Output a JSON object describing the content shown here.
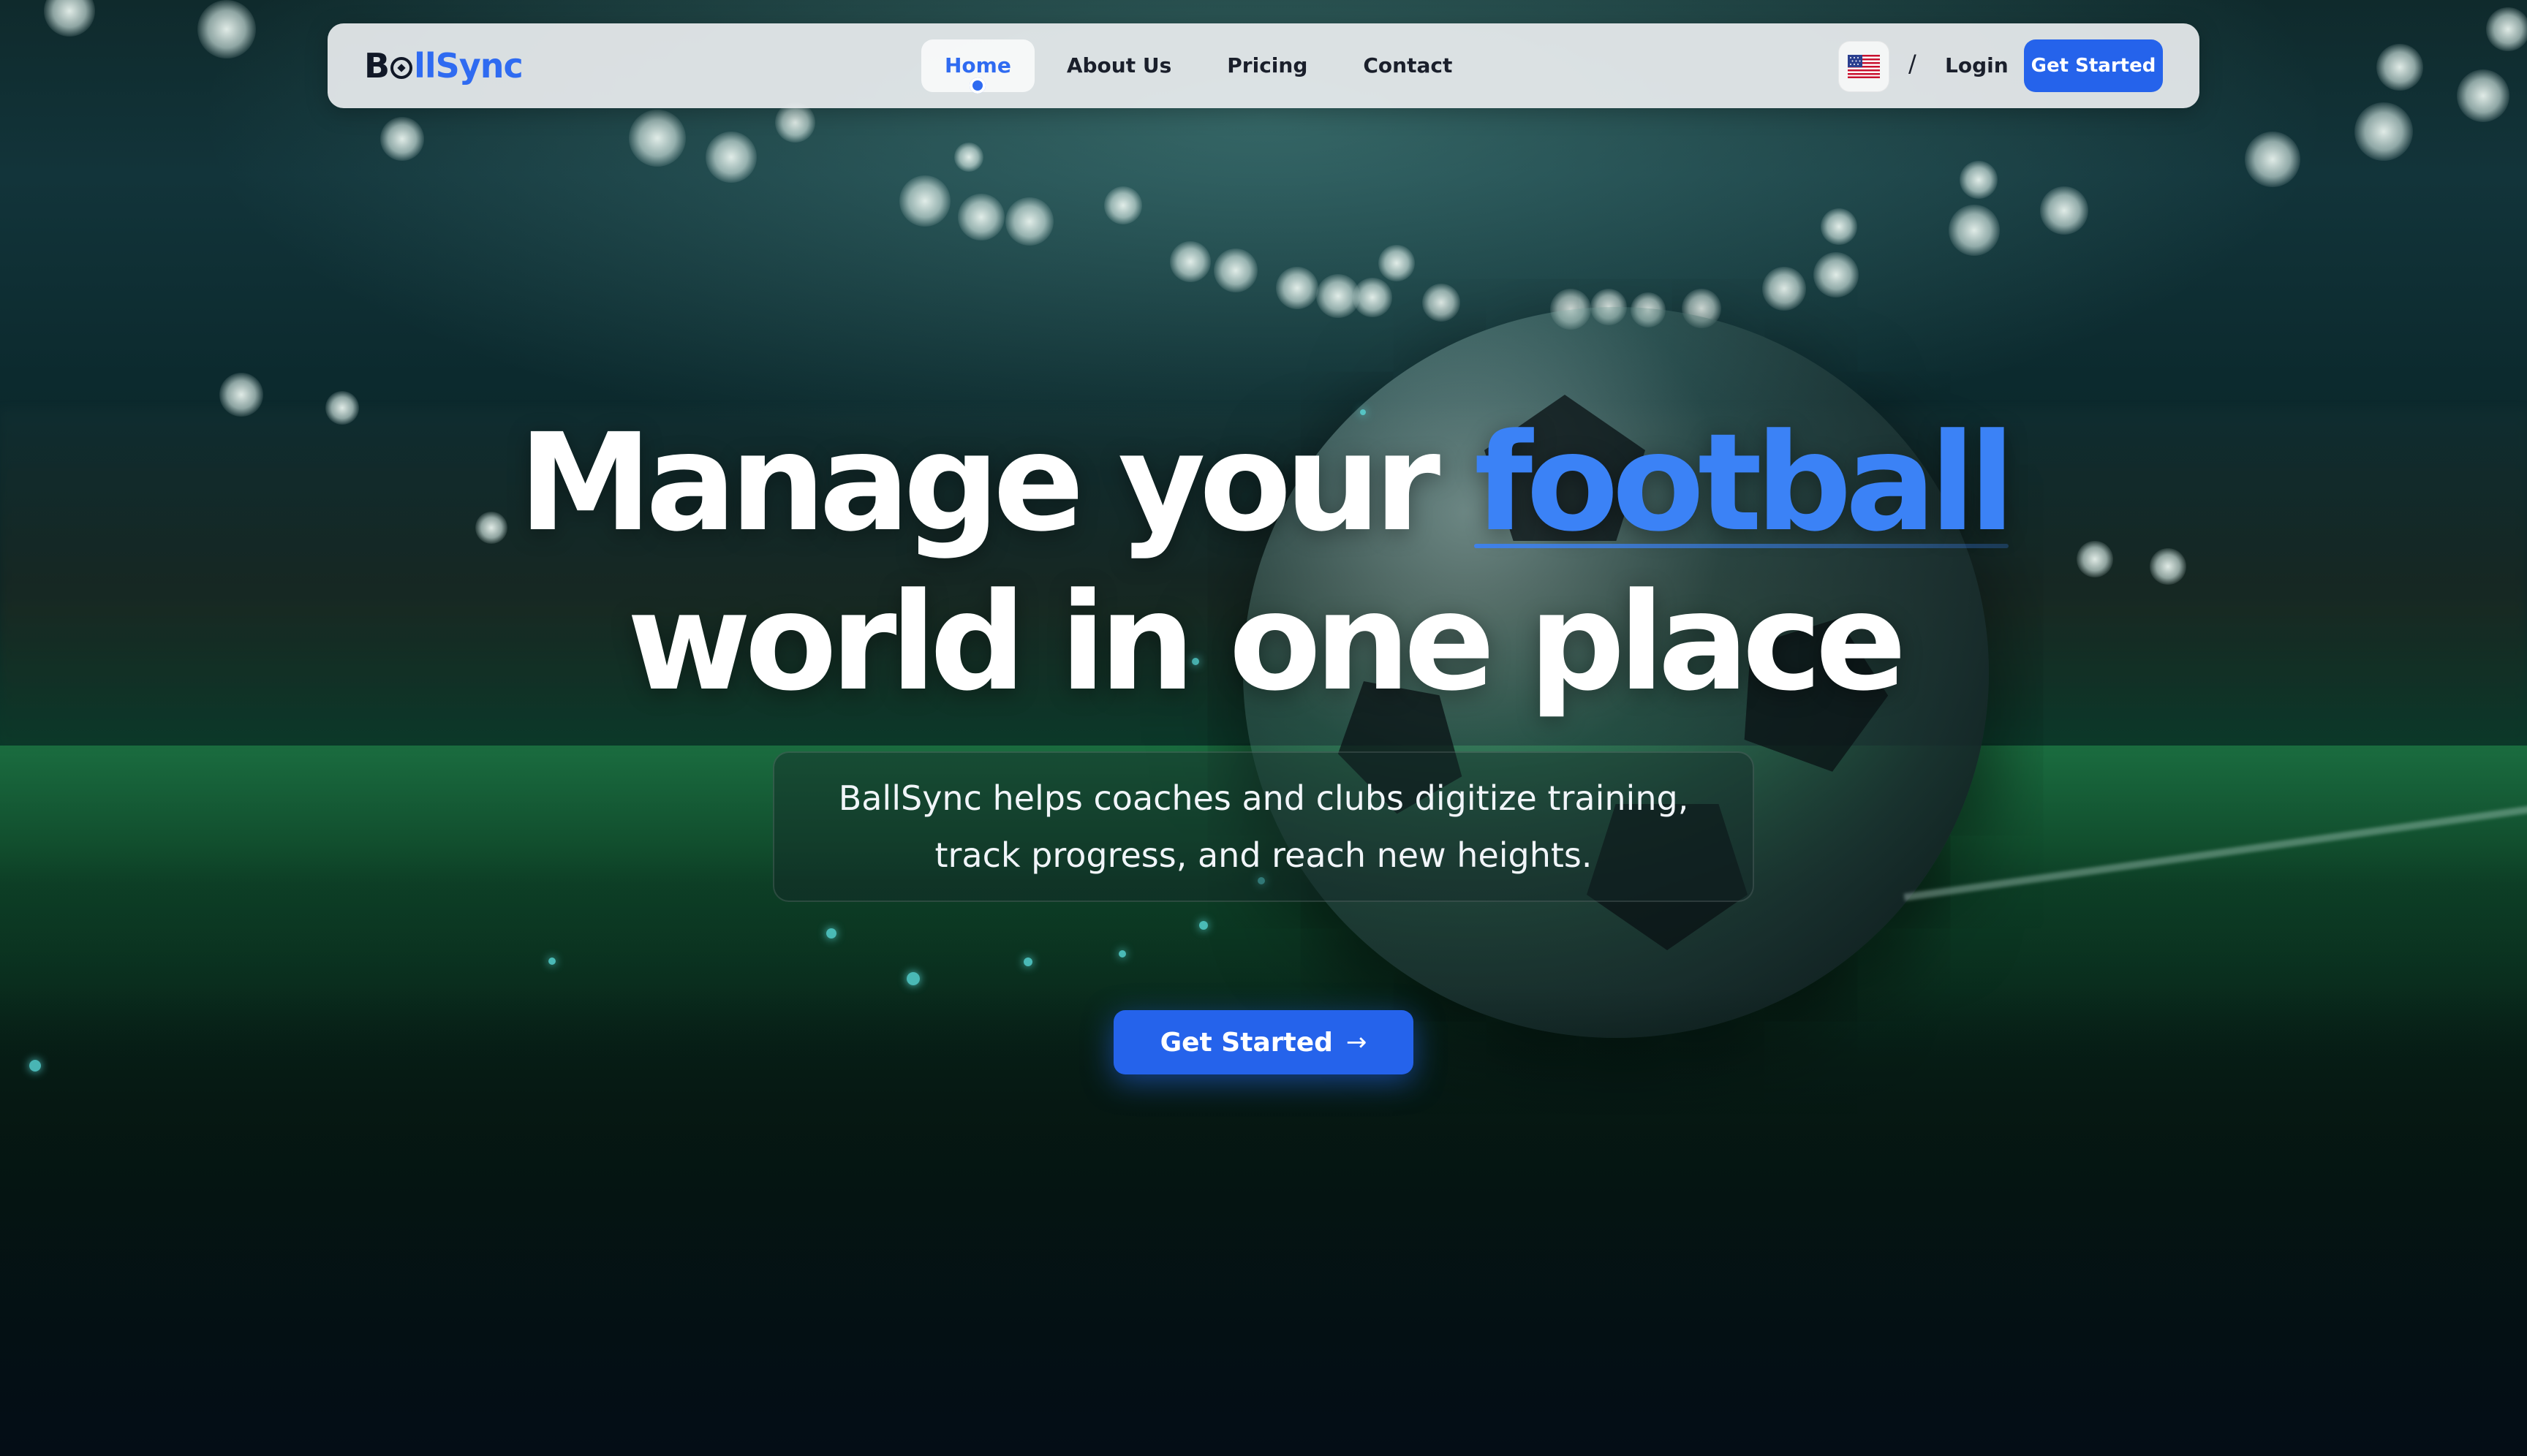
{
  "brand": {
    "logo_first": "B",
    "logo_rest": "llSync",
    "accent_color": "#2f6bf1"
  },
  "nav": {
    "links": [
      {
        "label": "Home",
        "active": true
      },
      {
        "label": "About Us",
        "active": false
      },
      {
        "label": "Pricing",
        "active": false
      },
      {
        "label": "Contact",
        "active": false
      }
    ],
    "language_icon": "us-flag-icon",
    "divider": "/",
    "login_label": "Login",
    "cta_label": "Get Started",
    "cta_color": "#2563eb"
  },
  "hero": {
    "title_part1": "Manage your ",
    "title_accent": "football",
    "title_line2": "world in one place",
    "accent_color": "#3b82f6",
    "subtitle_line1": "BallSync helps coaches and clubs digitize training,",
    "subtitle_line2": "track progress, and reach new heights.",
    "cta_label": "Get Started",
    "cta_icon": "arrow-right-icon"
  }
}
